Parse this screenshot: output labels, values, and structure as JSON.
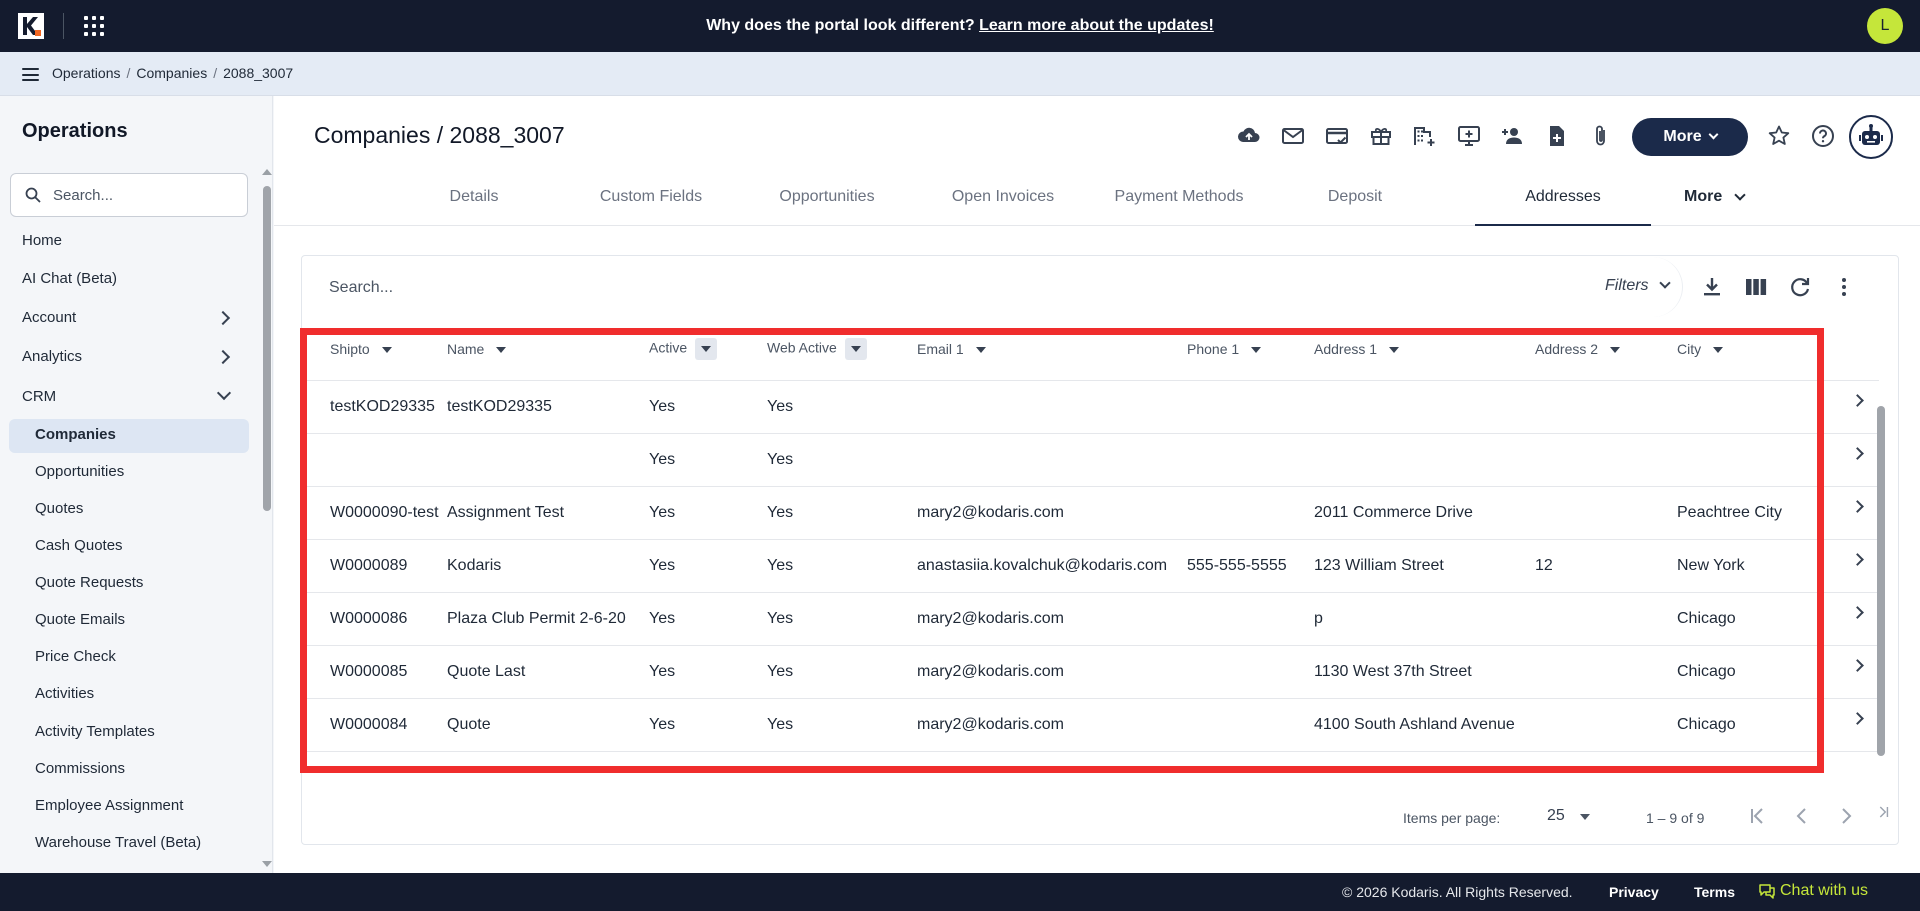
{
  "topbar": {
    "announcement_text": "Why does the portal look different? ",
    "announcement_link": "Learn more about the updates!",
    "avatar_initial": "L",
    "accent_color": "#c5e63a",
    "bg_color": "#141b2e"
  },
  "breadcrumb": {
    "items": [
      "Operations",
      "Companies",
      "2088_3007"
    ],
    "separator": "/"
  },
  "sidebar": {
    "title": "Operations",
    "search_placeholder": "Search...",
    "items": [
      {
        "label": "Home"
      },
      {
        "label": "AI Chat (Beta)"
      },
      {
        "label": "Account"
      },
      {
        "label": "Analytics"
      },
      {
        "label": "CRM"
      }
    ],
    "crm_items": [
      {
        "label": "Companies",
        "active": true
      },
      {
        "label": "Opportunities"
      },
      {
        "label": "Quotes"
      },
      {
        "label": "Cash Quotes"
      },
      {
        "label": "Quote Requests"
      },
      {
        "label": "Quote Emails"
      },
      {
        "label": "Price Check"
      },
      {
        "label": "Activities"
      },
      {
        "label": "Activity Templates"
      },
      {
        "label": "Commissions"
      },
      {
        "label": "Employee Assignment"
      },
      {
        "label": "Warehouse Travel (Beta)"
      }
    ]
  },
  "header": {
    "title": "Companies / 2088_3007",
    "more_label": "More",
    "toolbar_icons": [
      "cloud-upload-icon",
      "mail-icon",
      "card-check-icon",
      "gift-icon",
      "building-add-icon",
      "screen-add-icon",
      "person-add-icon",
      "file-add-icon",
      "paperclip-icon"
    ]
  },
  "tabs": {
    "items": [
      {
        "label": "Details"
      },
      {
        "label": "Custom Fields"
      },
      {
        "label": "Opportunities"
      },
      {
        "label": "Open Invoices"
      },
      {
        "label": "Payment Methods"
      },
      {
        "label": "Deposit"
      },
      {
        "label": "Addresses",
        "active": true
      }
    ],
    "more_label": "More"
  },
  "grid": {
    "search_placeholder": "Search...",
    "filters_label": "Filters",
    "columns": [
      "Shipto",
      "Name",
      "Active",
      "Web Active",
      "Email 1",
      "Phone 1",
      "Address 1",
      "Address 2",
      "City"
    ],
    "rows": [
      [
        "testKOD29335",
        "testKOD29335",
        "Yes",
        "Yes",
        "",
        "",
        "",
        "",
        ""
      ],
      [
        "",
        "",
        "Yes",
        "Yes",
        "",
        "",
        "",
        "",
        ""
      ],
      [
        "W0000090-test",
        "Assignment Test",
        "Yes",
        "Yes",
        "mary2@kodaris.com",
        "",
        "2011 Commerce Drive",
        "",
        "Peachtree City"
      ],
      [
        "W0000089",
        "Kodaris",
        "Yes",
        "Yes",
        "anastasiia.kovalchuk@kodaris.com",
        "555-555-5555",
        "123 William Street",
        "12",
        "New York"
      ],
      [
        "W0000086",
        "Plaza Club Permit 2-6-20",
        "Yes",
        "Yes",
        "mary2@kodaris.com",
        "",
        "p",
        "",
        "Chicago"
      ],
      [
        "W0000085",
        "Quote Last",
        "Yes",
        "Yes",
        "mary2@kodaris.com",
        "",
        "1130 West 37th Street",
        "",
        "Chicago"
      ],
      [
        "W0000084",
        "Quote",
        "Yes",
        "Yes",
        "mary2@kodaris.com",
        "",
        "4100 South Ashland Avenue",
        "",
        "Chicago"
      ]
    ],
    "items_per_page_label": "Items per page:",
    "items_per_page": "25",
    "range_label": "1 – 9 of 9"
  },
  "footer": {
    "copyright": "© 2026 Kodaris. All Rights Reserved.",
    "privacy": "Privacy",
    "terms": "Terms",
    "chat": "Chat with us"
  }
}
